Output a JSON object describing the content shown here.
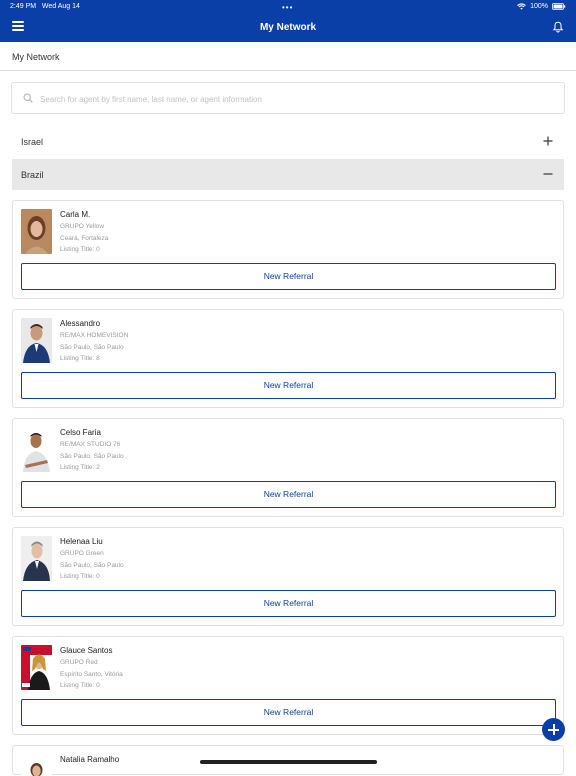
{
  "status_bar": {
    "time": "2:49 PM",
    "date": "Wed Aug 14",
    "battery": "100%"
  },
  "header": {
    "title": "My Network"
  },
  "subheader": {
    "label": "My Network"
  },
  "search": {
    "placeholder": "Search for agent by first name, last name, or agent information"
  },
  "countries": [
    {
      "name": "Israel",
      "expanded": false
    },
    {
      "name": "Brazil",
      "expanded": true
    }
  ],
  "agents": [
    {
      "name": "Carla M.",
      "company": "GRUPO Yellow",
      "location": "Ceará, Fortaleza",
      "listing": "Listing Title: 0",
      "button": "New Referral"
    },
    {
      "name": "Alessandro",
      "company": "RE/MAX HOMEVISION",
      "location": "São Paulo, São Paulo",
      "listing": "Listing Title: 8",
      "button": "New Referral"
    },
    {
      "name": "Celso Faria",
      "company": "RE/MAX STUDIO 76",
      "location": "São Paulo, São Paulo",
      "listing": "Listing Title: 2",
      "button": "New Referral"
    },
    {
      "name": "Helenaa Liu",
      "company": "GRUPO Green",
      "location": "São Paulo, São Paulo",
      "listing": "Listing Title: 0",
      "button": "New Referral"
    },
    {
      "name": "Glauce Santos",
      "company": "GRUPO Red",
      "location": "Espírito Santo, Vitória",
      "listing": "Listing Title: 0",
      "button": "New Referral"
    },
    {
      "name": "Natalia Ramalho"
    }
  ],
  "colors": {
    "brand": "#0b3fa8",
    "active_row": "#e8e8e8"
  }
}
